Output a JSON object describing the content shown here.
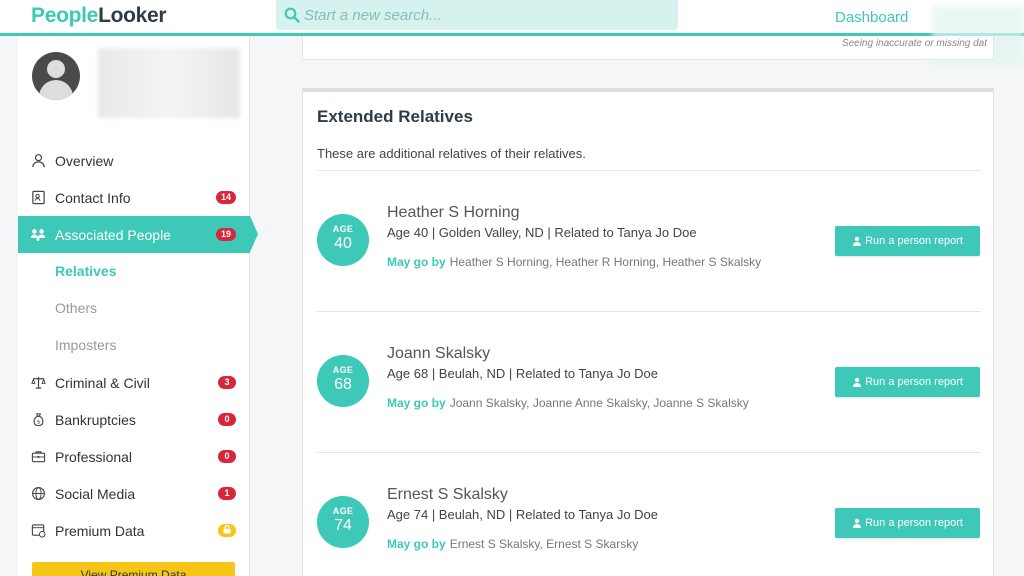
{
  "header": {
    "logo_part1": "People",
    "logo_part2": "Looker",
    "search_placeholder": "Start a new search...",
    "dashboard_link": "Dashboard"
  },
  "notice": "Seeing inaccurate or missing dat",
  "sidebar": {
    "items": [
      {
        "label": "Overview",
        "icon": "user-icon"
      },
      {
        "label": "Contact Info",
        "icon": "contact-card-icon",
        "badge": "14"
      },
      {
        "label": "Associated People",
        "icon": "people-icon",
        "badge": "19"
      },
      {
        "label": "Criminal & Civil",
        "icon": "scales-icon",
        "badge": "3"
      },
      {
        "label": "Bankruptcies",
        "icon": "money-bag-icon",
        "badge": "0"
      },
      {
        "label": "Professional",
        "icon": "briefcase-icon",
        "badge": "0"
      },
      {
        "label": "Social Media",
        "icon": "globe-icon",
        "badge": "1"
      },
      {
        "label": "Premium Data",
        "icon": "database-icon",
        "badge_icon": "lock-icon"
      }
    ],
    "subitems": [
      "Relatives",
      "Others",
      "Imposters"
    ],
    "premium_button": "View Premium Data"
  },
  "section": {
    "title": "Extended Relatives",
    "description": "These are additional relatives of their relatives."
  },
  "people": [
    {
      "age_label": "AGE",
      "age": "40",
      "name": "Heather S Horning",
      "details": "Age 40 | Golden Valley, ND | Related to Tanya Jo Doe",
      "may_go_by_label": "May go by",
      "aliases": "Heather S Horning, Heather R Horning, Heather S Skalsky",
      "button": "Run a person report"
    },
    {
      "age_label": "AGE",
      "age": "68",
      "name": "Joann Skalsky",
      "details": "Age 68 | Beulah, ND | Related to Tanya Jo Doe",
      "may_go_by_label": "May go by",
      "aliases": "Joann Skalsky, Joanne Anne Skalsky, Joanne S Skalsky",
      "button": "Run a person report"
    },
    {
      "age_label": "AGE",
      "age": "74",
      "name": "Ernest S Skalsky",
      "details": "Age 74 | Beulah, ND | Related to Tanya Jo Doe",
      "may_go_by_label": "May go by",
      "aliases": "Ernest S Skalsky, Ernest S Skarsky",
      "button": "Run a person report"
    }
  ],
  "colors": {
    "accent": "#3dc8b7",
    "badge_red": "#d9263a",
    "premium_yellow": "#f5c518"
  }
}
